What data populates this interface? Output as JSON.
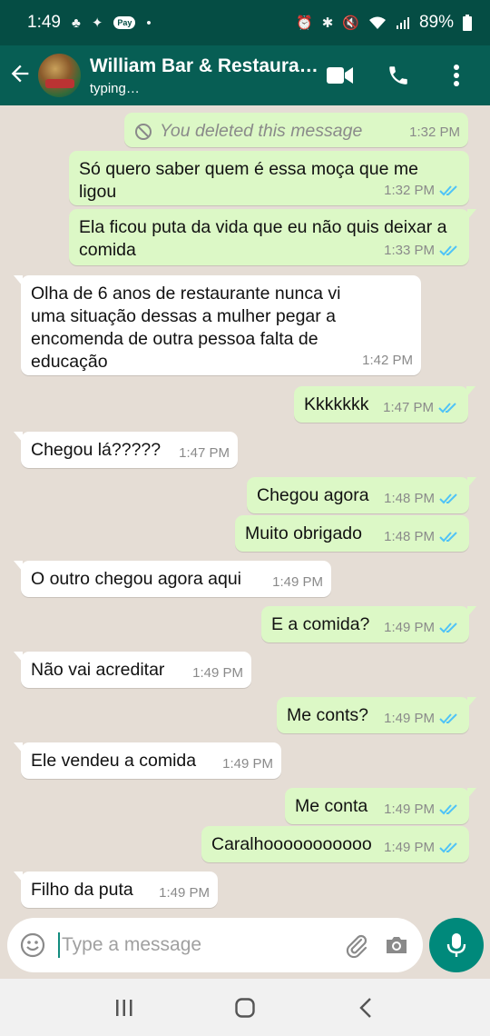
{
  "status_bar": {
    "time": "1:49",
    "battery": "89%",
    "pay_badge": "Pay"
  },
  "header": {
    "contact_name": "William Bar & Restaura…",
    "status": "typing…"
  },
  "messages": [
    {
      "dir": "out",
      "text": "You deleted this message",
      "time": "1:32 PM",
      "deleted": true
    },
    {
      "dir": "out",
      "text": "Só quero saber quem é essa moça que me ligou",
      "time": "1:32 PM"
    },
    {
      "dir": "out",
      "text": "Ela ficou puta da vida que eu não quis deixar a comida",
      "time": "1:33 PM"
    },
    {
      "dir": "in",
      "text": "Olha de 6 anos de restaurante nunca vi uma situação dessas a mulher pegar a encomenda de outra pessoa falta de educação",
      "time": "1:42 PM"
    },
    {
      "dir": "out",
      "text": "Kkkkkkk",
      "time": "1:47 PM"
    },
    {
      "dir": "in",
      "text": "Chegou lá?????",
      "time": "1:47 PM"
    },
    {
      "dir": "out",
      "text": "Chegou agora",
      "time": "1:48 PM"
    },
    {
      "dir": "out",
      "text": "Muito obrigado",
      "time": "1:48 PM"
    },
    {
      "dir": "in",
      "text": "O outro chegou agora aqui",
      "time": "1:49 PM"
    },
    {
      "dir": "out",
      "text": "E a comida?",
      "time": "1:49 PM"
    },
    {
      "dir": "in",
      "text": "Não vai acreditar",
      "time": "1:49 PM"
    },
    {
      "dir": "out",
      "text": "Me conts?",
      "time": "1:49 PM"
    },
    {
      "dir": "in",
      "text": "Ele vendeu a comida",
      "time": "1:49 PM"
    },
    {
      "dir": "out",
      "text": "Me conta",
      "time": "1:49 PM"
    },
    {
      "dir": "out",
      "text": "Caralhooooooooooo",
      "time": "1:49 PM"
    },
    {
      "dir": "in",
      "text": "Filho da puta",
      "time": "1:49 PM"
    }
  ],
  "composer": {
    "placeholder": "Type a message"
  },
  "colors": {
    "header": "#075e54",
    "status_bar": "#054d44",
    "outgoing": "#dcf8c6",
    "incoming": "#ffffff",
    "background": "#e5ddd5",
    "read_tick": "#4fc3f7",
    "fab": "#00897b"
  }
}
